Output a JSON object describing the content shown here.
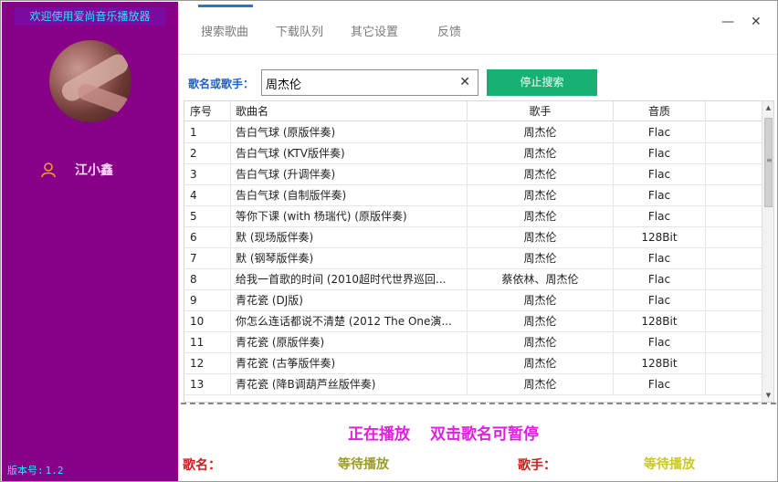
{
  "sidebar": {
    "welcome": "欢迎使用爱尚音乐播放器",
    "user_name": "江小鑫",
    "version_label": "版本号:",
    "version_value": "1.2"
  },
  "nav": {
    "tabs": [
      "搜索歌曲",
      "下载队列",
      "其它设置",
      "反馈"
    ],
    "active_tab": 0,
    "minimize": "—",
    "close": "✕"
  },
  "search": {
    "label": "歌名或歌手：",
    "value": "周杰伦",
    "clear": "✕",
    "stop_button": "停止搜索"
  },
  "table": {
    "headers": [
      "序号",
      "歌曲名",
      "歌手",
      "音质"
    ],
    "rows": [
      [
        "1",
        "告白气球 (原版伴奏)",
        "周杰伦",
        "Flac"
      ],
      [
        "2",
        "告白气球 (KTV版伴奏)",
        "周杰伦",
        "Flac"
      ],
      [
        "3",
        "告白气球 (升调伴奏)",
        "周杰伦",
        "Flac"
      ],
      [
        "4",
        "告白气球 (自制版伴奏)",
        "周杰伦",
        "Flac"
      ],
      [
        "5",
        "等你下课 (with 杨瑞代) (原版伴奏)",
        "周杰伦",
        "Flac"
      ],
      [
        "6",
        "默 (现场版伴奏)",
        "周杰伦",
        "128Bit"
      ],
      [
        "7",
        "默 (钢琴版伴奏)",
        "周杰伦",
        "Flac"
      ],
      [
        "8",
        "给我一首歌的时间 (2010超时代世界巡回...",
        "蔡依林、周杰伦",
        "Flac"
      ],
      [
        "9",
        "青花瓷 (DJ版)",
        "周杰伦",
        "Flac"
      ],
      [
        "10",
        "你怎么连话都说不清楚 (2012 The One演...",
        "周杰伦",
        "128Bit"
      ],
      [
        "11",
        "青花瓷 (原版伴奏)",
        "周杰伦",
        "Flac"
      ],
      [
        "12",
        "青花瓷 (古筝版伴奏)",
        "周杰伦",
        "128Bit"
      ],
      [
        "13",
        "青花瓷 (降B调葫芦丝版伴奏)",
        "周杰伦",
        "Flac"
      ]
    ]
  },
  "status": {
    "playing": "正在播放",
    "hint": "双击歌名可暂停",
    "song_label": "歌名：",
    "song_value": "等待播放",
    "singer_label": "歌手：",
    "singer_value": "等待播放"
  },
  "colors": {
    "sidebar": "#880088",
    "accent": "#2e6fd8",
    "stop_button": "#16b173",
    "playing": "#e01fe0"
  }
}
